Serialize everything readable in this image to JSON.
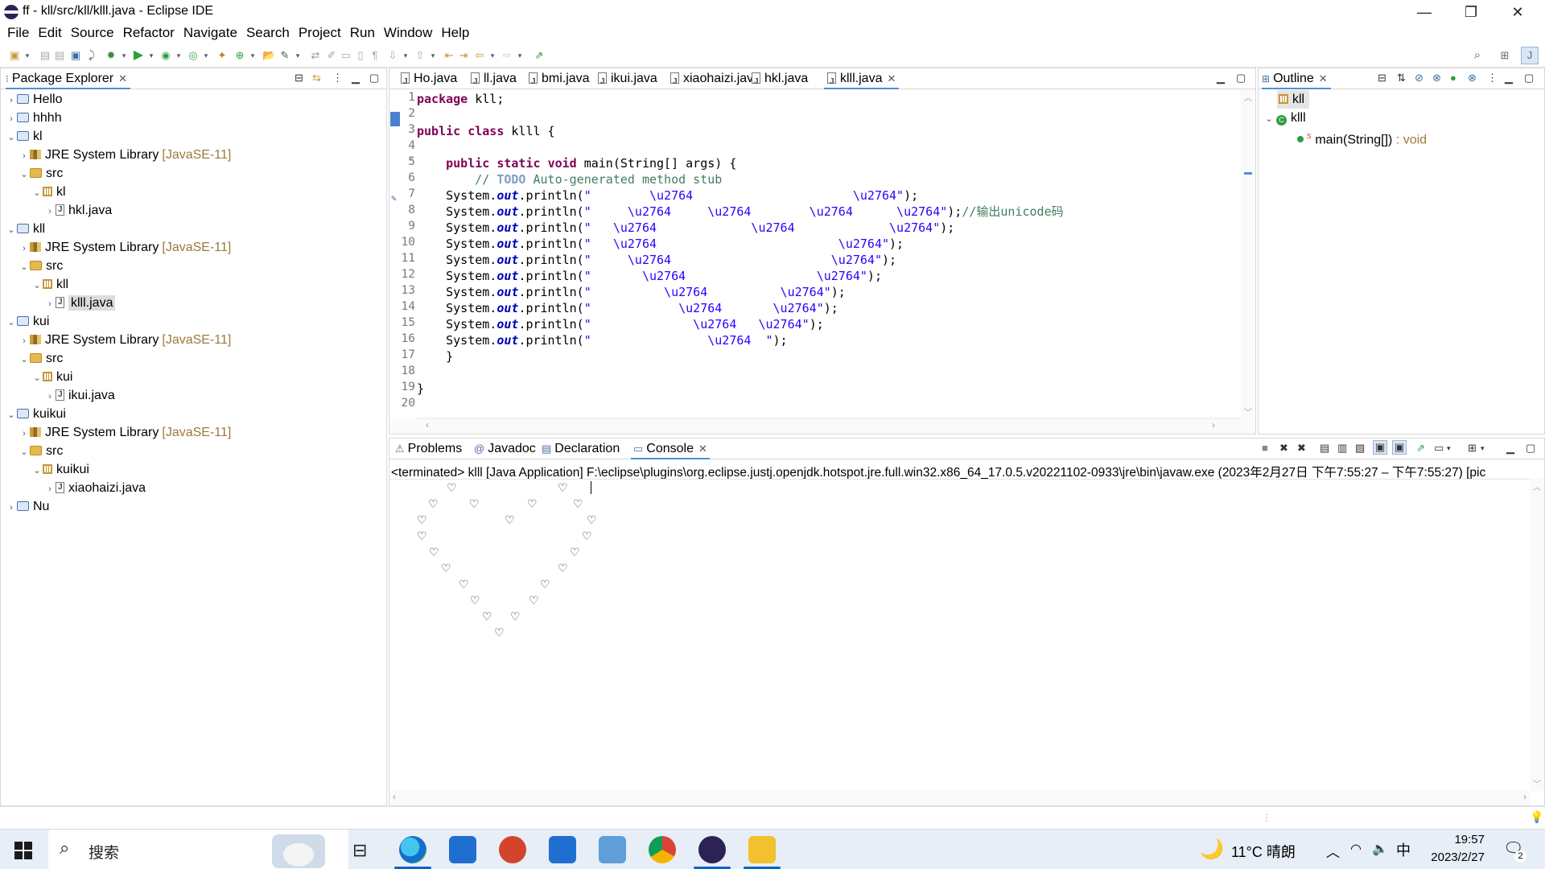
{
  "window": {
    "title": "ff - kll/src/kll/klll.java - Eclipse IDE",
    "min": "—",
    "max": "❐",
    "close": "✕"
  },
  "menu": [
    "File",
    "Edit",
    "Source",
    "Refactor",
    "Navigate",
    "Search",
    "Project",
    "Run",
    "Window",
    "Help"
  ],
  "package_explorer": {
    "title": "Package Explorer",
    "items": [
      {
        "label": "Hello",
        "type": "project",
        "depth": 0,
        "chev": "›"
      },
      {
        "label": "hhhh",
        "type": "project",
        "depth": 0,
        "chev": "›"
      },
      {
        "label": "kl",
        "type": "project",
        "depth": 0,
        "chev": "⌄"
      },
      {
        "label": "JRE System Library",
        "suffix": "[JavaSE-11]",
        "type": "lib",
        "depth": 1,
        "chev": "›"
      },
      {
        "label": "src",
        "type": "src",
        "depth": 1,
        "chev": "⌄"
      },
      {
        "label": "kl",
        "type": "pkg",
        "depth": 2,
        "chev": "⌄"
      },
      {
        "label": "hkl.java",
        "type": "file",
        "depth": 3,
        "chev": "›"
      },
      {
        "label": "kll",
        "type": "project",
        "depth": 0,
        "chev": "⌄"
      },
      {
        "label": "JRE System Library",
        "suffix": "[JavaSE-11]",
        "type": "lib",
        "depth": 1,
        "chev": "›"
      },
      {
        "label": "src",
        "type": "src",
        "depth": 1,
        "chev": "⌄"
      },
      {
        "label": "kll",
        "type": "pkg",
        "depth": 2,
        "chev": "⌄"
      },
      {
        "label": "klll.java",
        "type": "file",
        "depth": 3,
        "chev": "›",
        "selected": true
      },
      {
        "label": "kui",
        "type": "project",
        "depth": 0,
        "chev": "⌄"
      },
      {
        "label": "JRE System Library",
        "suffix": "[JavaSE-11]",
        "type": "lib",
        "depth": 1,
        "chev": "›"
      },
      {
        "label": "src",
        "type": "src",
        "depth": 1,
        "chev": "⌄"
      },
      {
        "label": "kui",
        "type": "pkg",
        "depth": 2,
        "chev": "⌄"
      },
      {
        "label": "ikui.java",
        "type": "file",
        "depth": 3,
        "chev": "›"
      },
      {
        "label": "kuikui",
        "type": "project",
        "depth": 0,
        "chev": "⌄"
      },
      {
        "label": "JRE System Library",
        "suffix": "[JavaSE-11]",
        "type": "lib",
        "depth": 1,
        "chev": "›"
      },
      {
        "label": "src",
        "type": "src",
        "depth": 1,
        "chev": "⌄"
      },
      {
        "label": "kuikui",
        "type": "pkg",
        "depth": 2,
        "chev": "⌄"
      },
      {
        "label": "xiaohaizi.java",
        "type": "file",
        "depth": 3,
        "chev": "›"
      },
      {
        "label": "Nu",
        "type": "project",
        "depth": 0,
        "chev": "›"
      }
    ]
  },
  "editor": {
    "tabs": [
      {
        "label": "Ho.java"
      },
      {
        "label": "ll.java"
      },
      {
        "label": "bmi.java"
      },
      {
        "label": "ikui.java"
      },
      {
        "label": "xiaohaizi.java"
      },
      {
        "label": "hkl.java"
      },
      {
        "label": "klll.java",
        "active": true
      }
    ],
    "lines": [
      [
        [
          "kw",
          "package"
        ],
        [
          "t",
          " kll;"
        ]
      ],
      [],
      [
        [
          "kw",
          "public"
        ],
        [
          "t",
          " "
        ],
        [
          "kw",
          "class"
        ],
        [
          "t",
          " klll {"
        ]
      ],
      [],
      [
        [
          "t",
          "    "
        ],
        [
          "kw",
          "public"
        ],
        [
          "t",
          " "
        ],
        [
          "kw",
          "static"
        ],
        [
          "t",
          " "
        ],
        [
          "kw",
          "void"
        ],
        [
          "t",
          " main(String[] args) {"
        ]
      ],
      [
        [
          "t",
          "        "
        ],
        [
          "cm",
          "// "
        ],
        [
          "todo",
          "TODO"
        ],
        [
          "cm",
          " Auto-generated method stub"
        ]
      ],
      [
        [
          "t",
          "    System."
        ],
        [
          "fld",
          "out"
        ],
        [
          "t",
          ".println("
        ],
        [
          "st",
          "\"        \\u2764                      \\u2764\""
        ],
        [
          "t",
          ");"
        ]
      ],
      [
        [
          "t",
          "    System."
        ],
        [
          "fld",
          "out"
        ],
        [
          "t",
          ".println("
        ],
        [
          "st",
          "\"     \\u2764     \\u2764        \\u2764      \\u2764\""
        ],
        [
          "t",
          ");"
        ],
        [
          "cm",
          "//输出unicode码"
        ]
      ],
      [
        [
          "t",
          "    System."
        ],
        [
          "fld",
          "out"
        ],
        [
          "t",
          ".println("
        ],
        [
          "st",
          "\"   \\u2764             \\u2764             \\u2764\""
        ],
        [
          "t",
          ");"
        ]
      ],
      [
        [
          "t",
          "    System."
        ],
        [
          "fld",
          "out"
        ],
        [
          "t",
          ".println("
        ],
        [
          "st",
          "\"   \\u2764                         \\u2764\""
        ],
        [
          "t",
          ");"
        ]
      ],
      [
        [
          "t",
          "    System."
        ],
        [
          "fld",
          "out"
        ],
        [
          "t",
          ".println("
        ],
        [
          "st",
          "\"     \\u2764                      \\u2764\""
        ],
        [
          "t",
          ");"
        ]
      ],
      [
        [
          "t",
          "    System."
        ],
        [
          "fld",
          "out"
        ],
        [
          "t",
          ".println("
        ],
        [
          "st",
          "\"       \\u2764                  \\u2764\""
        ],
        [
          "t",
          ");"
        ]
      ],
      [
        [
          "t",
          "    System."
        ],
        [
          "fld",
          "out"
        ],
        [
          "t",
          ".println("
        ],
        [
          "st",
          "\"          \\u2764          \\u2764\""
        ],
        [
          "t",
          ");"
        ]
      ],
      [
        [
          "t",
          "    System."
        ],
        [
          "fld",
          "out"
        ],
        [
          "t",
          ".println("
        ],
        [
          "st",
          "\"            \\u2764       \\u2764\""
        ],
        [
          "t",
          ");"
        ]
      ],
      [
        [
          "t",
          "    System."
        ],
        [
          "fld",
          "out"
        ],
        [
          "t",
          ".println("
        ],
        [
          "st",
          "\"              \\u2764   \\u2764\""
        ],
        [
          "t",
          ");"
        ]
      ],
      [
        [
          "t",
          "    System."
        ],
        [
          "fld",
          "out"
        ],
        [
          "t",
          ".println("
        ],
        [
          "st",
          "\"                \\u2764  \""
        ],
        [
          "t",
          ");"
        ]
      ],
      [
        [
          "t",
          "    }"
        ]
      ],
      [],
      [
        [
          "t",
          "}"
        ]
      ],
      []
    ]
  },
  "outline": {
    "title": "Outline",
    "items": [
      {
        "label": "kll",
        "kind": "package"
      },
      {
        "label": "klll",
        "kind": "class"
      },
      {
        "label": "main(String[])",
        "suffix": " : void",
        "kind": "method"
      }
    ]
  },
  "bottom": {
    "tabs": [
      {
        "label": "Problems"
      },
      {
        "label": "Javadoc"
      },
      {
        "label": "Declaration"
      },
      {
        "label": "Console",
        "active": true
      }
    ],
    "console_header": "<terminated> klll [Java Application] F:\\eclipse\\plugins\\org.eclipse.justj.openjdk.hotspot.jre.full.win32.x86_64_17.0.5.v20221102-0933\\jre\\bin\\javaw.exe  (2023年2月27日 下午7:55:27 – 下午7:55:27) [pic",
    "heart_char": "♡",
    "heart_rows": [
      [
        66,
        204
      ],
      [
        43,
        94,
        166,
        223
      ],
      [
        29,
        138,
        240
      ],
      [
        29,
        234
      ],
      [
        44,
        219
      ],
      [
        59,
        204
      ],
      [
        81,
        182
      ],
      [
        95,
        168
      ],
      [
        110,
        145
      ],
      [
        125
      ]
    ]
  },
  "taskbar": {
    "search": "搜索",
    "weather": "11°C 晴朗",
    "ime": "中",
    "time": "19:57",
    "date": "2023/2/27",
    "notif": "2"
  },
  "colors": {
    "accent": "#0067c0",
    "keyword": "#7f0055",
    "string": "#2a00ff",
    "comment": "#3f7f5f"
  }
}
